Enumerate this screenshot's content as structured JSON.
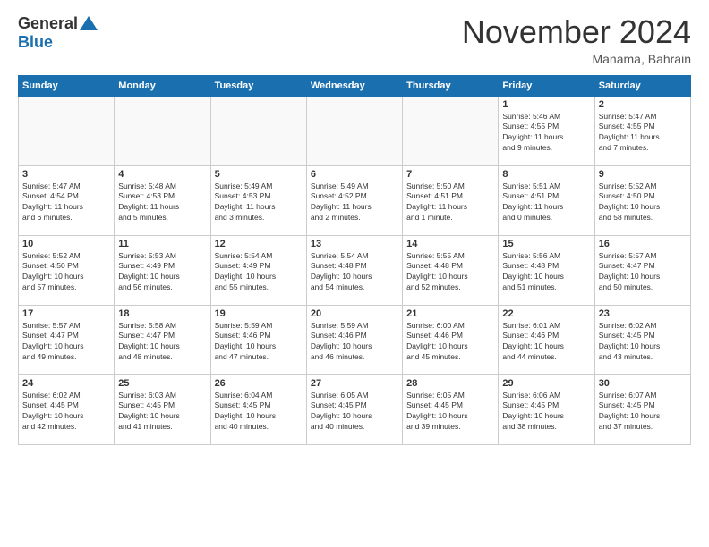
{
  "header": {
    "logo_general": "General",
    "logo_blue": "Blue",
    "month_title": "November 2024",
    "location": "Manama, Bahrain"
  },
  "weekdays": [
    "Sunday",
    "Monday",
    "Tuesday",
    "Wednesday",
    "Thursday",
    "Friday",
    "Saturday"
  ],
  "weeks": [
    [
      {
        "day": "",
        "info": ""
      },
      {
        "day": "",
        "info": ""
      },
      {
        "day": "",
        "info": ""
      },
      {
        "day": "",
        "info": ""
      },
      {
        "day": "",
        "info": ""
      },
      {
        "day": "1",
        "info": "Sunrise: 5:46 AM\nSunset: 4:55 PM\nDaylight: 11 hours\nand 9 minutes."
      },
      {
        "day": "2",
        "info": "Sunrise: 5:47 AM\nSunset: 4:55 PM\nDaylight: 11 hours\nand 7 minutes."
      }
    ],
    [
      {
        "day": "3",
        "info": "Sunrise: 5:47 AM\nSunset: 4:54 PM\nDaylight: 11 hours\nand 6 minutes."
      },
      {
        "day": "4",
        "info": "Sunrise: 5:48 AM\nSunset: 4:53 PM\nDaylight: 11 hours\nand 5 minutes."
      },
      {
        "day": "5",
        "info": "Sunrise: 5:49 AM\nSunset: 4:53 PM\nDaylight: 11 hours\nand 3 minutes."
      },
      {
        "day": "6",
        "info": "Sunrise: 5:49 AM\nSunset: 4:52 PM\nDaylight: 11 hours\nand 2 minutes."
      },
      {
        "day": "7",
        "info": "Sunrise: 5:50 AM\nSunset: 4:51 PM\nDaylight: 11 hours\nand 1 minute."
      },
      {
        "day": "8",
        "info": "Sunrise: 5:51 AM\nSunset: 4:51 PM\nDaylight: 11 hours\nand 0 minutes."
      },
      {
        "day": "9",
        "info": "Sunrise: 5:52 AM\nSunset: 4:50 PM\nDaylight: 10 hours\nand 58 minutes."
      }
    ],
    [
      {
        "day": "10",
        "info": "Sunrise: 5:52 AM\nSunset: 4:50 PM\nDaylight: 10 hours\nand 57 minutes."
      },
      {
        "day": "11",
        "info": "Sunrise: 5:53 AM\nSunset: 4:49 PM\nDaylight: 10 hours\nand 56 minutes."
      },
      {
        "day": "12",
        "info": "Sunrise: 5:54 AM\nSunset: 4:49 PM\nDaylight: 10 hours\nand 55 minutes."
      },
      {
        "day": "13",
        "info": "Sunrise: 5:54 AM\nSunset: 4:48 PM\nDaylight: 10 hours\nand 54 minutes."
      },
      {
        "day": "14",
        "info": "Sunrise: 5:55 AM\nSunset: 4:48 PM\nDaylight: 10 hours\nand 52 minutes."
      },
      {
        "day": "15",
        "info": "Sunrise: 5:56 AM\nSunset: 4:48 PM\nDaylight: 10 hours\nand 51 minutes."
      },
      {
        "day": "16",
        "info": "Sunrise: 5:57 AM\nSunset: 4:47 PM\nDaylight: 10 hours\nand 50 minutes."
      }
    ],
    [
      {
        "day": "17",
        "info": "Sunrise: 5:57 AM\nSunset: 4:47 PM\nDaylight: 10 hours\nand 49 minutes."
      },
      {
        "day": "18",
        "info": "Sunrise: 5:58 AM\nSunset: 4:47 PM\nDaylight: 10 hours\nand 48 minutes."
      },
      {
        "day": "19",
        "info": "Sunrise: 5:59 AM\nSunset: 4:46 PM\nDaylight: 10 hours\nand 47 minutes."
      },
      {
        "day": "20",
        "info": "Sunrise: 5:59 AM\nSunset: 4:46 PM\nDaylight: 10 hours\nand 46 minutes."
      },
      {
        "day": "21",
        "info": "Sunrise: 6:00 AM\nSunset: 4:46 PM\nDaylight: 10 hours\nand 45 minutes."
      },
      {
        "day": "22",
        "info": "Sunrise: 6:01 AM\nSunset: 4:46 PM\nDaylight: 10 hours\nand 44 minutes."
      },
      {
        "day": "23",
        "info": "Sunrise: 6:02 AM\nSunset: 4:45 PM\nDaylight: 10 hours\nand 43 minutes."
      }
    ],
    [
      {
        "day": "24",
        "info": "Sunrise: 6:02 AM\nSunset: 4:45 PM\nDaylight: 10 hours\nand 42 minutes."
      },
      {
        "day": "25",
        "info": "Sunrise: 6:03 AM\nSunset: 4:45 PM\nDaylight: 10 hours\nand 41 minutes."
      },
      {
        "day": "26",
        "info": "Sunrise: 6:04 AM\nSunset: 4:45 PM\nDaylight: 10 hours\nand 40 minutes."
      },
      {
        "day": "27",
        "info": "Sunrise: 6:05 AM\nSunset: 4:45 PM\nDaylight: 10 hours\nand 40 minutes."
      },
      {
        "day": "28",
        "info": "Sunrise: 6:05 AM\nSunset: 4:45 PM\nDaylight: 10 hours\nand 39 minutes."
      },
      {
        "day": "29",
        "info": "Sunrise: 6:06 AM\nSunset: 4:45 PM\nDaylight: 10 hours\nand 38 minutes."
      },
      {
        "day": "30",
        "info": "Sunrise: 6:07 AM\nSunset: 4:45 PM\nDaylight: 10 hours\nand 37 minutes."
      }
    ]
  ]
}
